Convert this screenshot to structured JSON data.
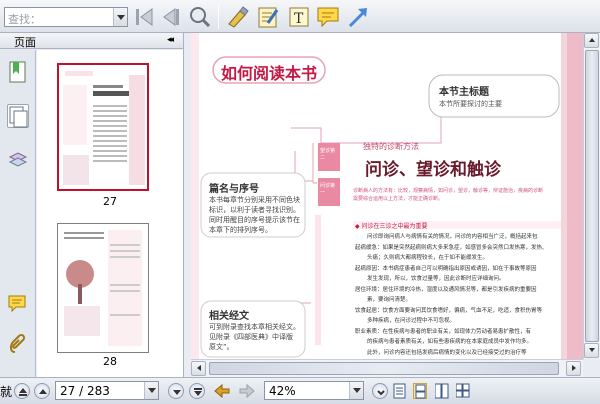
{
  "toolbar": {
    "search_placeholder": "查找：",
    "icons": [
      "first-page-icon",
      "find-prev-icon",
      "find-next-icon",
      "magnifier-search-icon",
      "highlighter-icon",
      "note-icon",
      "text-icon",
      "comment-icon",
      "arrow-tool-icon"
    ]
  },
  "left_panel": {
    "title": "页面",
    "collapse_glyph": "◂◂",
    "tabs": [
      "bookmark-tab-icon",
      "pages-tab-icon",
      "layers-tab-icon",
      "comments-tab-icon",
      "attachments-tab-icon"
    ],
    "thumbnails": [
      {
        "page": "27",
        "selected": true
      },
      {
        "page": "28",
        "selected": false
      }
    ]
  },
  "document": {
    "page_title": "如何阅读本书",
    "chapter_small": "独特的诊断方法",
    "chapter_title": "问诊、望诊和触诊",
    "callout_topic_title": "本节主标题",
    "callout_topic_desc": "本节所要探讨的主要",
    "callout_title_title": "篇名与序号",
    "callout_title_desc": [
      "本书每章节分别采用不同色块",
      "标识，以利于读者寻找识别。",
      "同时用醒目的序号提示该节在",
      "本章下的排列序号。"
    ],
    "callout_ref_title": "相关经文",
    "callout_ref_desc": [
      "可到附录查找本章相关经文。",
      "见附录《四部医典》中译版",
      "原文”。"
    ],
    "intro_text": [
      "诊断病人的方法有：比较，观察病情，如问诊，望诊，触诊等，辩证施治，疾病的诊断",
      "需要综合运用以上方法，才能正确诊断。"
    ],
    "section_head": "◆ 问诊在三诊之中最为重要",
    "body_lines": [
      "问诊即询问病人与病情有关的情况，问诊的内容相当广泛，概括起来包",
      "起病缓急：如果是突然起病则病大多来急症，如感冒多会突然口发热寒，发热、",
      "头痛；久则病大都病程较长，在于如不能缓发生。",
      "起病原因：本书病症患者自己可以明确指出原因或诱因，如在于事故等原因",
      "发生发现，所以，饮食过量等，因此诊断时应详细询问。",
      "居住环境：居住环境的冷热，湿度以及通风情况等，都是引发疾病的重要因",
      "素，要询问清楚。",
      "饮食起居：饮食方面要询问其饮食嗜好，偏病，气血不足，吃适，食积伤胃等",
      "多种疾病，在问诊过程中不可忽视。",
      "职业素质：在性疾病与患者的职业有关，如现体力劳动者易患扩散性，有",
      "的疾病与患者素质有关，如有些患疾病的在本家庭成员中发作均多。",
      "此外，问诊内容还包括发病后病情的变化以及已经接受过的治疗等"
    ],
    "side_badge_top": "望诊第二",
    "side_badge_bottom": "问诊第一"
  },
  "navigation": {
    "page_display": "27 / 283",
    "zoom_display": "42%",
    "left_truncated": "就"
  },
  "colors": {
    "accent_pink": "#e06c88",
    "selection_red": "#c0102a",
    "toolbar_bg": "#e4e8ee"
  }
}
